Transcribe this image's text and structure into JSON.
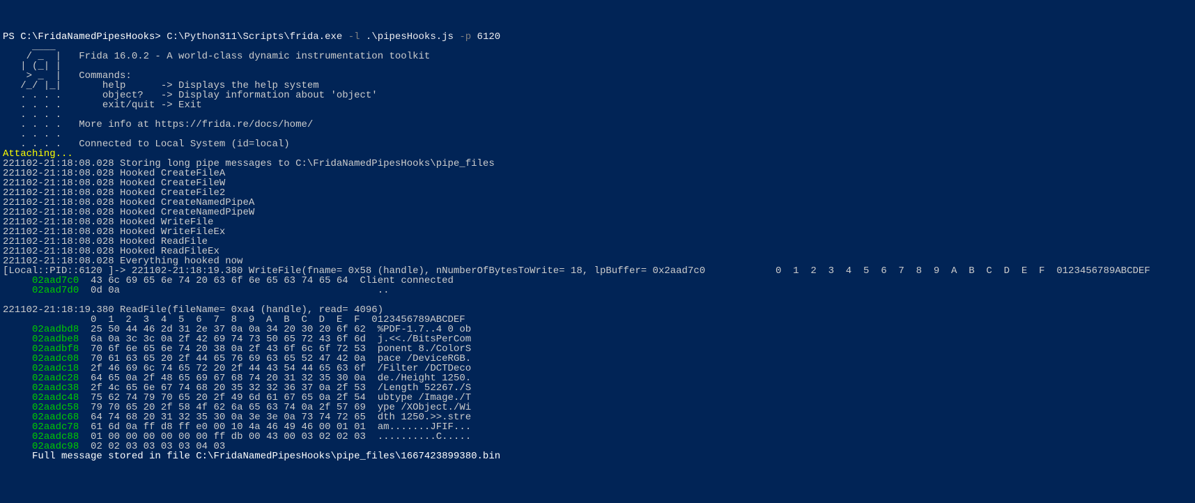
{
  "prompt": {
    "ps": "PS C:\\FridaNamedPipesHooks>",
    "exe": " C:\\Python311\\Scripts\\frida.exe",
    "flag1": " -l",
    "script": " .\\pipesHooks.js",
    "flag2": " -p",
    "pid": " 6120"
  },
  "banner": [
    "     ____",
    "    / _  |   Frida 16.0.2 - A world-class dynamic instrumentation toolkit",
    "   | (_| |",
    "    > _  |   Commands:",
    "   /_/ |_|       help      -> Displays the help system",
    "   . . . .       object?   -> Display information about 'object'",
    "   . . . .       exit/quit -> Exit",
    "   . . . .",
    "   . . . .   More info at https://frida.re/docs/home/",
    "   . . . .",
    "   . . . .   Connected to Local System (id=local)"
  ],
  "attaching": "Attaching...",
  "hooks": [
    "221102-21:18:08.028 Storing long pipe messages to C:\\FridaNamedPipesHooks\\pipe_files",
    "221102-21:18:08.028 Hooked CreateFileA",
    "221102-21:18:08.028 Hooked CreateFileW",
    "221102-21:18:08.028 Hooked CreateFile2",
    "221102-21:18:08.028 Hooked CreateNamedPipeA",
    "221102-21:18:08.028 Hooked CreateNamedPipeW",
    "221102-21:18:08.028 Hooked WriteFile",
    "221102-21:18:08.028 Hooked WriteFileEx",
    "221102-21:18:08.028 Hooked ReadFile",
    "221102-21:18:08.028 Hooked ReadFileEx",
    "221102-21:18:08.028 Everything hooked now"
  ],
  "writeCall": {
    "prefix": "[Local::PID::6120 ]-> 221102-21:18:19.380 WriteFile(fname= 0x58 (handle), nNumberOfBytesToWrite= 18, lpBuffer= 0x2aad7c0            0  1  2  3  4  5  6  7  8  9  A  B  C  D  E  F  0123456789ABCDEF"
  },
  "dump1": [
    {
      "addr": "02aad7c0",
      "hex": "  43 6c 69 65 6e 74 20 63 6f 6e 65 63 74 65 64",
      "ascii": "  Client connected"
    },
    {
      "addr": "02aad7d0",
      "hex": "  0d 0a                                          ",
      "ascii": "  .."
    }
  ],
  "readCall": "221102-21:18:19.380 ReadFile(fileName= 0xa4 (handle), read= 4096)",
  "readHeader": "               0  1  2  3  4  5  6  7  8  9  A  B  C  D  E  F  0123456789ABCDEF",
  "dump2": [
    {
      "addr": "02aadbd8",
      "hex": "  25 50 44 46 2d 31 2e 37 0a 0a 34 20 30 20 6f 62",
      "ascii": "  %PDF-1.7..4 0 ob"
    },
    {
      "addr": "02aadbe8",
      "hex": "  6a 0a 3c 3c 0a 2f 42 69 74 73 50 65 72 43 6f 6d",
      "ascii": "  j.<<./BitsPerCom"
    },
    {
      "addr": "02aadbf8",
      "hex": "  70 6f 6e 65 6e 74 20 38 0a 2f 43 6f 6c 6f 72 53",
      "ascii": "  ponent 8./ColorS"
    },
    {
      "addr": "02aadc08",
      "hex": "  70 61 63 65 20 2f 44 65 76 69 63 65 52 47 42 0a",
      "ascii": "  pace /DeviceRGB."
    },
    {
      "addr": "02aadc18",
      "hex": "  2f 46 69 6c 74 65 72 20 2f 44 43 54 44 65 63 6f",
      "ascii": "  /Filter /DCTDeco"
    },
    {
      "addr": "02aadc28",
      "hex": "  64 65 0a 2f 48 65 69 67 68 74 20 31 32 35 30 0a",
      "ascii": "  de./Height 1250."
    },
    {
      "addr": "02aadc38",
      "hex": "  2f 4c 65 6e 67 74 68 20 35 32 32 36 37 0a 2f 53",
      "ascii": "  /Length 52267./S"
    },
    {
      "addr": "02aadc48",
      "hex": "  75 62 74 79 70 65 20 2f 49 6d 61 67 65 0a 2f 54",
      "ascii": "  ubtype /Image./T"
    },
    {
      "addr": "02aadc58",
      "hex": "  79 70 65 20 2f 58 4f 62 6a 65 63 74 0a 2f 57 69",
      "ascii": "  ype /XObject./Wi"
    },
    {
      "addr": "02aadc68",
      "hex": "  64 74 68 20 31 32 35 30 0a 3e 3e 0a 73 74 72 65",
      "ascii": "  dth 1250.>>.stre"
    },
    {
      "addr": "02aadc78",
      "hex": "  61 6d 0a ff d8 ff e0 00 10 4a 46 49 46 00 01 01",
      "ascii": "  am.......JFIF..."
    },
    {
      "addr": "02aadc88",
      "hex": "  01 00 00 00 00 00 00 ff db 00 43 00 03 02 02 03",
      "ascii": "  ..........C....."
    },
    {
      "addr": "02aadc98",
      "hex": "  02 02 03 03 03 03 04 03                        ",
      "ascii": ""
    }
  ],
  "footer": "     Full message stored in file C:\\FridaNamedPipesHooks\\pipe_files\\1667423899380.bin"
}
